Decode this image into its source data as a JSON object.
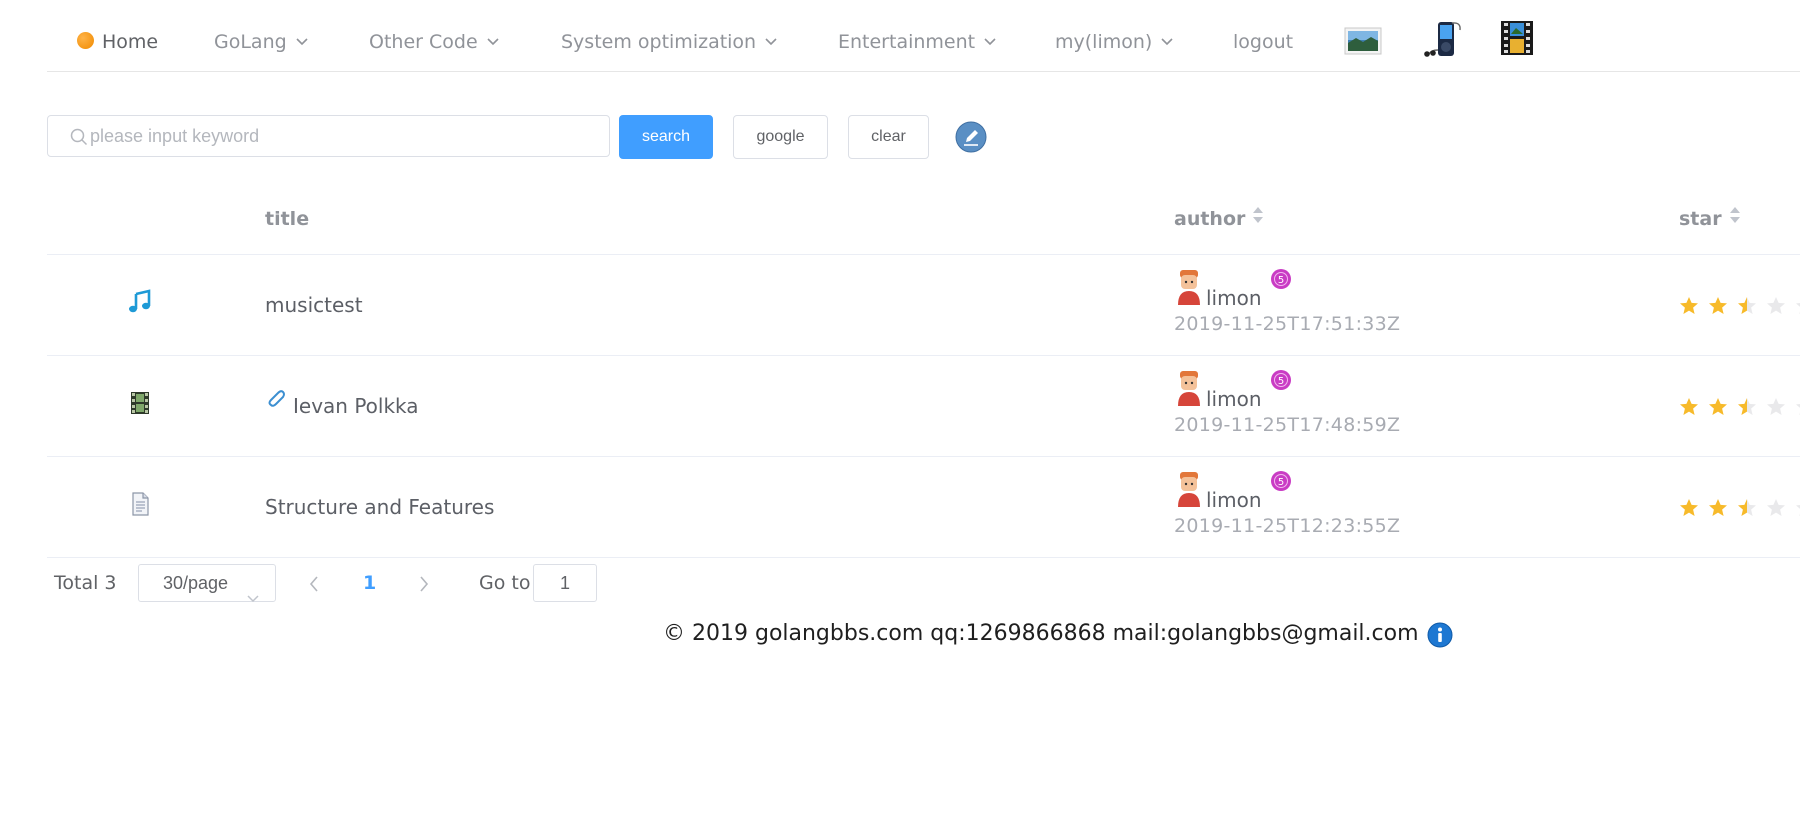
{
  "nav": {
    "home": "Home",
    "items": [
      {
        "label": "GoLang"
      },
      {
        "label": "Other Code"
      },
      {
        "label": "System optimization"
      },
      {
        "label": "Entertainment"
      },
      {
        "label": "my(limon)"
      }
    ],
    "logout": "logout",
    "image_icons": [
      "landscape-image-icon",
      "mp3-player-icon",
      "film-strip-icon"
    ]
  },
  "search": {
    "placeholder": "please input keyword",
    "value": "",
    "search_label": "search",
    "google_label": "google",
    "clear_label": "clear"
  },
  "table": {
    "columns": {
      "title": "title",
      "author": "author",
      "star": "star"
    },
    "rows": [
      {
        "type_icon": "music-note-icon",
        "title": "musictest",
        "has_attachment": false,
        "author": "limon",
        "date": "2019-11-25T17:51:33Z",
        "stars": 2.5
      },
      {
        "type_icon": "film-icon",
        "title": "Ievan Polkka",
        "has_attachment": true,
        "author": "limon",
        "date": "2019-11-25T17:48:59Z",
        "stars": 2.5
      },
      {
        "type_icon": "document-icon",
        "title": "Structure and Features",
        "has_attachment": false,
        "author": "limon",
        "date": "2019-11-25T12:23:55Z",
        "stars": 2.5
      }
    ]
  },
  "pagination": {
    "total": "Total 3",
    "page_size": "30/page",
    "current_page": "1",
    "goto_label": "Go to",
    "goto_value": "1"
  },
  "footer": {
    "text": "© 2019 golangbbs.com qq:1269866868 mail:golangbbs@gmail.com"
  },
  "colors": {
    "primary": "#409eff",
    "star": "#f7ba2a",
    "badge": "#c93cc4",
    "muted_text": "#909399"
  }
}
